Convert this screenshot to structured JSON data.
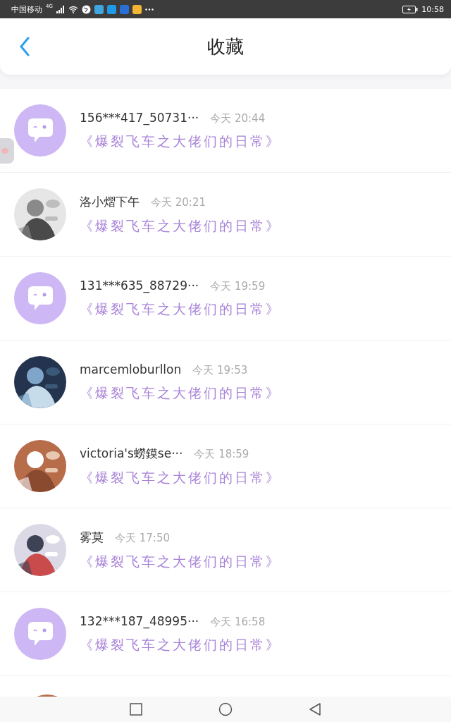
{
  "status_bar": {
    "carrier": "中国移动",
    "network": "4G",
    "time": "10:58"
  },
  "header": {
    "title": "收藏"
  },
  "rows": [
    {
      "avatar": {
        "kind": "default"
      },
      "name": "156***417_50731···",
      "time": "今天 20:44",
      "title": "《爆裂飞车之大佬们的日常》"
    },
    {
      "name": "洛小熠下午",
      "time": "今天 20:21",
      "title": "《爆裂飞车之大佬们的日常》"
    },
    {
      "avatar": {
        "kind": "default"
      },
      "name": "131***635_88729···",
      "time": "今天 19:59",
      "title": "《爆裂飞车之大佬们的日常》"
    },
    {
      "name": "marcemloburllon",
      "time": "今天 19:53",
      "title": "《爆裂飞车之大佬们的日常》"
    },
    {
      "name": "victoria's蟧鏌se···",
      "time": "今天 18:59",
      "title": "《爆裂飞车之大佬们的日常》"
    },
    {
      "name": "雾莫",
      "time": "今天 17:50",
      "title": "《爆裂飞车之大佬们的日常》"
    },
    {
      "avatar": {
        "kind": "default"
      },
      "name": "132***187_48995···",
      "time": "今天 16:58",
      "title": "《爆裂飞车之大佬们的日常》"
    }
  ]
}
